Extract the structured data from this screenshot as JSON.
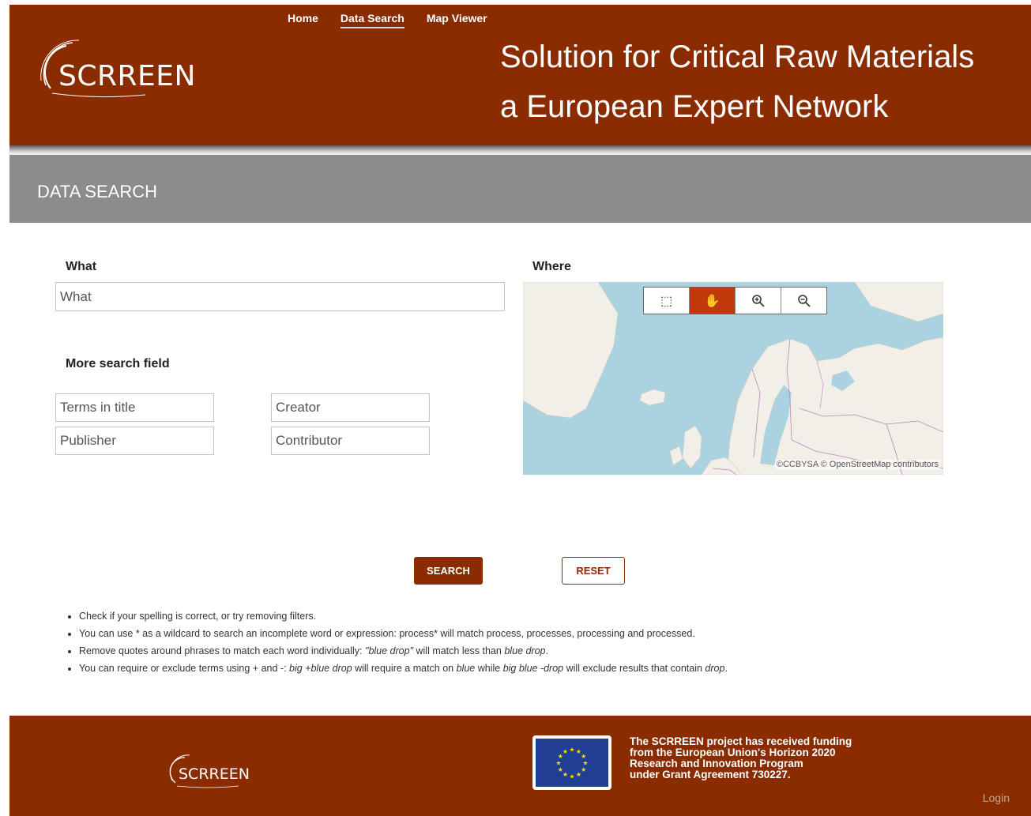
{
  "brand": {
    "logo_text": "SCRREEN"
  },
  "nav": [
    {
      "label": "Home",
      "active": false
    },
    {
      "label": "Data Search",
      "active": true
    },
    {
      "label": "Map Viewer",
      "active": false
    }
  ],
  "tagline": {
    "line1": "Solution for Critical Raw Materials",
    "line2": "a European Expert Network"
  },
  "section": {
    "title": "DATA SEARCH"
  },
  "form": {
    "what_label": "What",
    "what_placeholder": "What",
    "more_label": "More search field",
    "fields": {
      "terms_in_title": "Terms in title",
      "creator": "Creator",
      "publisher": "Publisher",
      "contributor": "Contributor"
    },
    "where_label": "Where"
  },
  "map": {
    "attribution": "©CCBYSA © OpenStreetMap contributors",
    "tools": [
      {
        "icon": "box-select-icon",
        "active": false
      },
      {
        "icon": "pan-hand-icon",
        "active": true
      },
      {
        "icon": "zoom-in-icon",
        "active": false
      },
      {
        "icon": "zoom-out-icon",
        "active": false
      }
    ]
  },
  "buttons": {
    "search": "SEARCH",
    "reset": "RESET"
  },
  "tips": {
    "t1": "Check if your spelling is correct, or try removing filters.",
    "t2": "You can use * as a wildcard to search an incomplete word or expression: process* will match process, processes, processing and processed.",
    "t3a": "Remove quotes around phrases to match each word individually: ",
    "t3b": "\"blue drop\"",
    "t3c": " will match less than ",
    "t3d": "blue drop",
    "t3e": ".",
    "t4a": "You can require or exclude terms using + and -: ",
    "t4b": "big +blue drop",
    "t4c": " will require a match on ",
    "t4d": "blue",
    "t4e": " while ",
    "t4f": "big blue -drop",
    "t4g": " will exclude results that contain ",
    "t4h": "drop",
    "t4i": "."
  },
  "footer": {
    "logo_text": "SCRREEN",
    "funding_l1": "The SCRREEN project has received funding",
    "funding_l2": "from the European Union's Horizon 2020",
    "funding_l3": "Research and Innovation Program",
    "funding_l4": "under Grant Agreement 730227.",
    "login": "Login"
  },
  "colors": {
    "brand": "#8a2c00",
    "section_bar": "#8c8c8c",
    "active_tool": "#c0390b",
    "map_water": "#aad3df",
    "map_land": "#f2efe9"
  }
}
